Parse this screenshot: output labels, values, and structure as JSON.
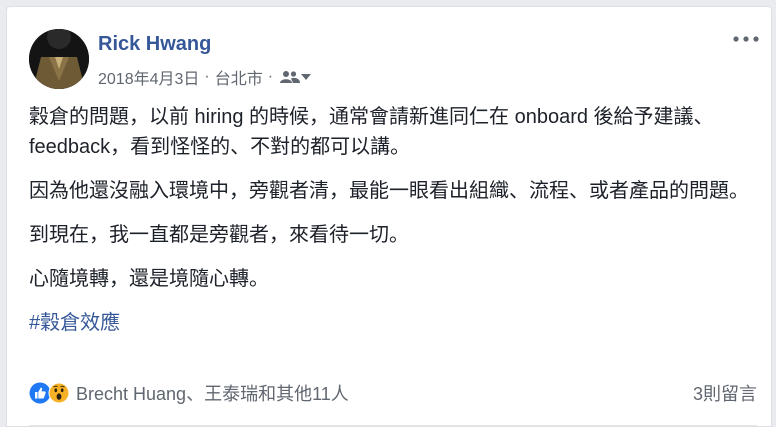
{
  "post": {
    "author": "Rick Hwang",
    "date": "2018年4月3日",
    "separator": "·",
    "location": "台北市",
    "audience_icon": "friends-icon",
    "paragraphs": [
      "穀倉的問題，以前 hiring 的時候，通常會請新進同仁在 onboard 後給予建議、feedback，看到怪怪的、不對的都可以講。",
      "因為他還沒融入環境中，旁觀者清，最能一眼看出組織、流程、或者產品的問題。",
      "到現在，我一直都是旁觀者，來看待一切。",
      "心隨境轉，還是境隨心轉。"
    ],
    "hashtag": "#穀倉效應"
  },
  "footer": {
    "reactions_text": "Brecht Huang、王泰瑞和其他11人",
    "comments_text": "3則留言"
  },
  "colors": {
    "link": "#365899",
    "meta": "#616770",
    "like": "#2078f4",
    "wow": "#f7b125"
  }
}
